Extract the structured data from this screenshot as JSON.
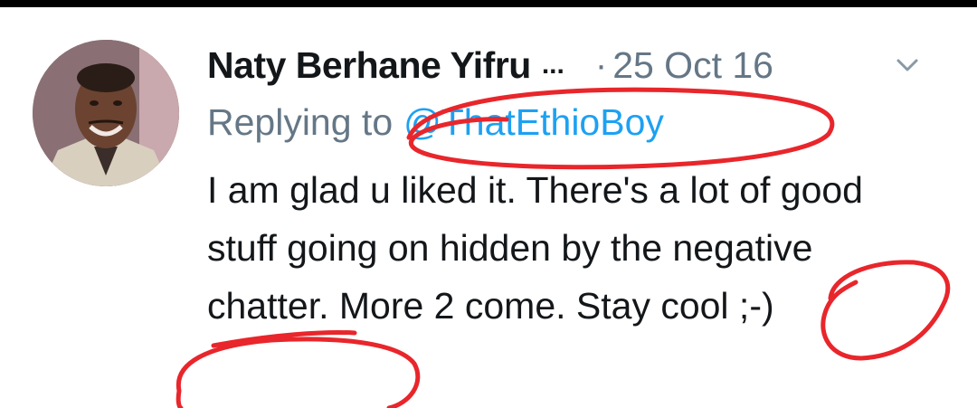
{
  "tweet": {
    "author_name": "Naty Berhane Yifru",
    "name_ellipsis": "...",
    "separator": "·",
    "timestamp": "25 Oct 16",
    "replying_label": "Replying to",
    "reply_handle": "@ThatEthioBoy",
    "text": "I am glad u liked it. There's a lot of good stuff going on hidden by the negative chatter. More 2 come. Stay cool ;-)",
    "menu_icon": "chevron-down-icon",
    "avatar_icon": "avatar-photo"
  },
  "colors": {
    "text_primary": "#14171a",
    "text_secondary": "#657786",
    "link": "#1da1f2",
    "annotation": "#e8262b"
  }
}
